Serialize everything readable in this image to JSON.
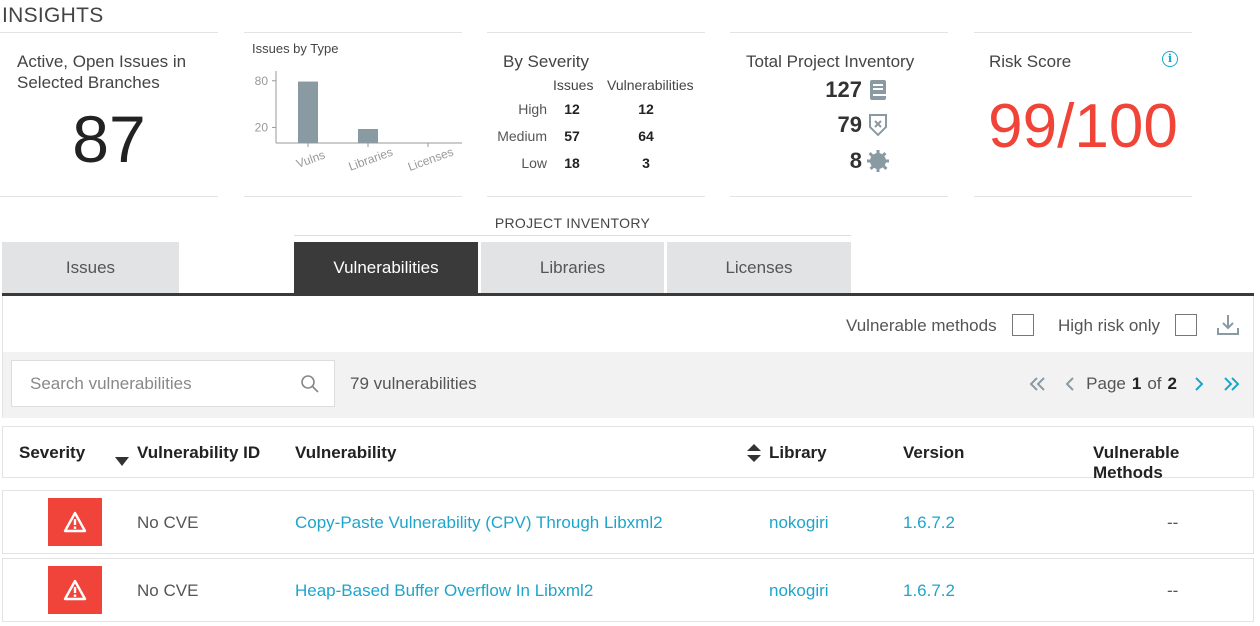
{
  "insights_title": "INSIGHTS",
  "open_issues": {
    "title_line1": "Active, Open Issues in",
    "title_line2": "Selected Branches",
    "value": "87"
  },
  "issues_by_type": {
    "title": "Issues by Type"
  },
  "chart_data": {
    "type": "bar",
    "title": "Issues by Type",
    "categories": [
      "Vulns",
      "Libraries",
      "Licenses"
    ],
    "values": [
      79,
      18,
      0
    ],
    "yticks": [
      "80",
      "20"
    ],
    "ylim": [
      0,
      90
    ],
    "color": "#8a9aa3"
  },
  "by_severity": {
    "title": "By Severity",
    "col_issues": "Issues",
    "col_vulns": "Vulnerabilities",
    "rows": [
      {
        "label": "High",
        "issues": "12",
        "vulns": "12"
      },
      {
        "label": "Medium",
        "issues": "57",
        "vulns": "64"
      },
      {
        "label": "Low",
        "issues": "18",
        "vulns": "3"
      }
    ]
  },
  "inventory": {
    "title": "Total Project Inventory",
    "libraries": "127",
    "vulnerabilities": "79",
    "licenses": "8",
    "icons": [
      "book-icon",
      "shield-x-icon",
      "badge-gear-icon"
    ]
  },
  "risk": {
    "title": "Risk Score",
    "value": "99/100",
    "color": "#f04438",
    "info_glyph": "i"
  },
  "project_inventory_label": "PROJECT INVENTORY",
  "tabs": {
    "issues": "Issues",
    "vulnerabilities": "Vulnerabilities",
    "libraries": "Libraries",
    "licenses": "Licenses",
    "active": "vulnerabilities"
  },
  "filters": {
    "vulnerable_methods": "Vulnerable methods",
    "high_risk_only": "High risk only"
  },
  "search": {
    "placeholder": "Search vulnerabilities",
    "count_text": "79 vulnerabilities"
  },
  "pager": {
    "page_word": "Page",
    "current": "1",
    "of_word": "of",
    "total": "2"
  },
  "table": {
    "headers": {
      "severity": "Severity",
      "vuln_id": "Vulnerability ID",
      "vulnerability": "Vulnerability",
      "library": "Library",
      "version": "Version",
      "vulnerable_methods": "Vulnerable Methods"
    },
    "rows": [
      {
        "id": "No CVE",
        "name": "Copy-Paste Vulnerability (CPV) Through Libxml2",
        "library": "nokogiri",
        "version": "1.6.7.2",
        "methods": "--"
      },
      {
        "id": "No CVE",
        "name": "Heap-Based Buffer Overflow In Libxml2",
        "library": "nokogiri",
        "version": "1.6.7.2",
        "methods": "--"
      }
    ]
  },
  "colors": {
    "accent": "#1ea5cc",
    "danger": "#f0443a",
    "tab_active": "#3a3a3a"
  }
}
